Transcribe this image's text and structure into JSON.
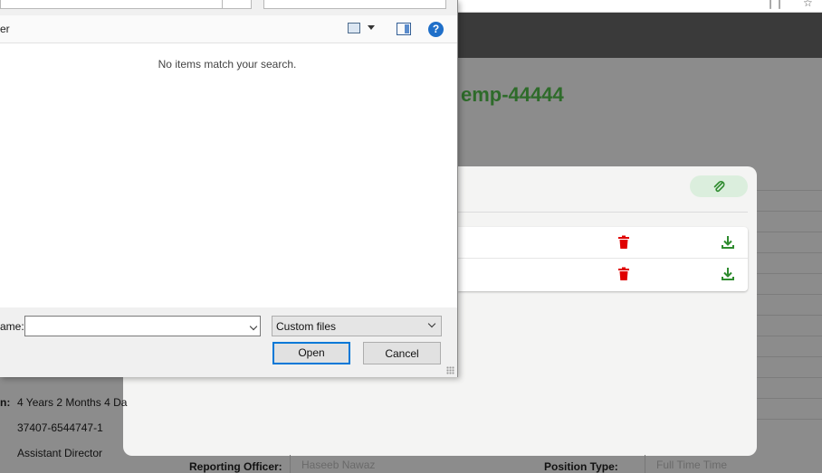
{
  "page": {
    "title": "emp-44444"
  },
  "employee": {
    "service_label_partial": "n:",
    "service_value": "4 Years 2 Months 4 Da",
    "cnic_value": "37407-6544747-1",
    "designation_value": "Assistant Director",
    "reporting_officer_label": "Reporting Officer:",
    "reporting_officer_value": "Haseeb Nawaz",
    "position_type_label": "Position Type:",
    "position_type_value": "Full Time Time"
  },
  "attachments": {
    "rows": [
      {
        "name": ""
      },
      {
        "name": ""
      }
    ],
    "colors": {
      "delete": "#e00000",
      "download": "#2e8b2e",
      "attach_bg": "#dbeedd"
    }
  },
  "file_dialog": {
    "toolbar_left_text": "er",
    "empty_message": "No items match your search.",
    "filename_label": "ame:",
    "filename_value": "",
    "file_type": "Custom files",
    "open_label": "Open",
    "cancel_label": "Cancel",
    "icons": [
      "view-options-icon",
      "preview-pane-icon",
      "help-icon"
    ]
  }
}
